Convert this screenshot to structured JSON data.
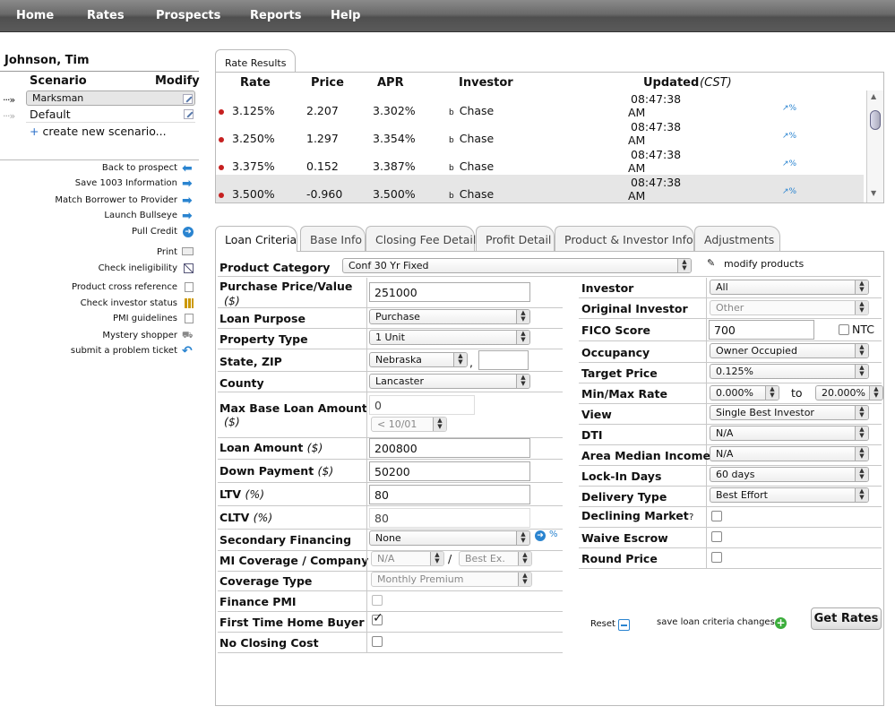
{
  "nav": [
    "Home",
    "Rates",
    "Prospects",
    "Reports",
    "Help"
  ],
  "client_name": "Johnson, Tim",
  "scenario": {
    "head_label": "Scenario",
    "modify_label": "Modify",
    "items": [
      "Marksman",
      "Default"
    ],
    "create_label": "create new scenario..."
  },
  "actions": [
    {
      "label": "Back to prospect",
      "icon": "arrow-left-icon"
    },
    {
      "label": "Save 1003 Information",
      "icon": "arrow-right-icon"
    },
    {
      "label": "Match Borrower to Provider",
      "icon": "arrow-right-icon"
    },
    {
      "label": "Launch Bullseye",
      "icon": "arrow-right-icon"
    },
    {
      "label": "Pull Credit",
      "icon": "circle-arrow-icon"
    },
    {
      "label": "Print",
      "icon": "printer-icon"
    },
    {
      "label": "Check ineligibility",
      "icon": "no-entry-icon"
    },
    {
      "label": "Product cross reference",
      "icon": "document-icon"
    },
    {
      "label": "Check investor status",
      "icon": "bar-chart-icon"
    },
    {
      "label": "PMI guidelines",
      "icon": "document-icon"
    },
    {
      "label": "Mystery shopper",
      "icon": "cart-icon"
    },
    {
      "label": "submit a problem ticket",
      "icon": "reply-arrow-icon"
    }
  ],
  "rate_results": {
    "tab": "Rate Results",
    "headers": {
      "rate": "Rate",
      "price": "Price",
      "apr": "APR",
      "investor": "Investor",
      "updated": "Updated",
      "tz": "(CST)"
    },
    "rows": [
      {
        "rate": "3.125%",
        "price": "2.207",
        "apr": "3.302%",
        "investor": "Chase",
        "time": "08:47:38",
        "ampm": "AM"
      },
      {
        "rate": "3.250%",
        "price": "1.297",
        "apr": "3.354%",
        "investor": "Chase",
        "time": "08:47:38",
        "ampm": "AM"
      },
      {
        "rate": "3.375%",
        "price": "0.152",
        "apr": "3.387%",
        "investor": "Chase",
        "time": "08:47:38",
        "ampm": "AM"
      },
      {
        "rate": "3.500%",
        "price": "-0.960",
        "apr": "3.500%",
        "investor": "Chase",
        "time": "08:47:38",
        "ampm": "AM"
      }
    ],
    "investor_badge": "b",
    "chart_glyph": "↗%"
  },
  "tabs": [
    "Loan Criteria",
    "Base Info",
    "Closing Fee Detail",
    "Profit Detail",
    "Product & Investor Info",
    "Adjustments"
  ],
  "form": {
    "product_category": {
      "label": "Product Category",
      "value": "Conf 30 Yr Fixed"
    },
    "modify_products": "modify products",
    "purchase_price": {
      "label": "Purchase Price/Value",
      "unit": "($)",
      "value": "251000"
    },
    "loan_purpose": {
      "label": "Loan Purpose",
      "value": "Purchase"
    },
    "property_type": {
      "label": "Property Type",
      "value": "1 Unit"
    },
    "state_zip": {
      "label": "State, ZIP",
      "state": "Nebraska",
      "zip": "",
      "comma": ","
    },
    "county": {
      "label": "County",
      "value": "Lancaster"
    },
    "max_base": {
      "label": "Max Base Loan Amount",
      "unit": "($)",
      "value": "0",
      "date": "< 10/01"
    },
    "loan_amount": {
      "label": "Loan Amount",
      "unit": "($)",
      "value": "200800"
    },
    "down_payment": {
      "label": "Down Payment",
      "unit": "($)",
      "value": "50200"
    },
    "ltv": {
      "label": "LTV",
      "unit": "(%)",
      "value": "80"
    },
    "cltv": {
      "label": "CLTV",
      "unit": "(%)",
      "value": "80"
    },
    "secondary_financing": {
      "label": "Secondary Financing",
      "value": "None",
      "pct": "%"
    },
    "mi_coverage": {
      "label": "MI Coverage / Company",
      "value": "N/A",
      "slash": "/",
      "company": "Best Ex."
    },
    "coverage_type": {
      "label": "Coverage Type",
      "value": "Monthly Premium"
    },
    "finance_pmi": {
      "label": "Finance PMI",
      "checked": false
    },
    "first_time_buyer": {
      "label": "First Time Home Buyer",
      "checked": true
    },
    "no_closing_cost": {
      "label": "No Closing Cost",
      "checked": false
    },
    "investor": {
      "label": "Investor",
      "value": "All"
    },
    "original_investor": {
      "label": "Original Investor",
      "value": "Other"
    },
    "fico": {
      "label": "FICO Score",
      "value": "700",
      "ntc": "NTC"
    },
    "occupancy": {
      "label": "Occupancy",
      "value": "Owner Occupied"
    },
    "target_price": {
      "label": "Target Price",
      "value": "0.125%"
    },
    "min_max_rate": {
      "label": "Min/Max Rate",
      "min": "0.000%",
      "to": "to",
      "max": "20.000%"
    },
    "view": {
      "label": "View",
      "value": "Single Best Investor"
    },
    "dti": {
      "label": "DTI",
      "value": "N/A"
    },
    "area_median_income": {
      "label": "Area Median Income",
      "value": "N/A"
    },
    "lock_in_days": {
      "label": "Lock-In Days",
      "value": "60 days"
    },
    "delivery_type": {
      "label": "Delivery Type",
      "value": "Best Effort"
    },
    "declining_market": {
      "label": "Declining Market",
      "help": "?",
      "checked": false
    },
    "waive_escrow": {
      "label": "Waive Escrow",
      "checked": false
    },
    "round_price": {
      "label": "Round Price",
      "checked": false
    },
    "reset": "Reset",
    "save_changes": "save loan criteria changes",
    "get_rates": "Get Rates"
  }
}
